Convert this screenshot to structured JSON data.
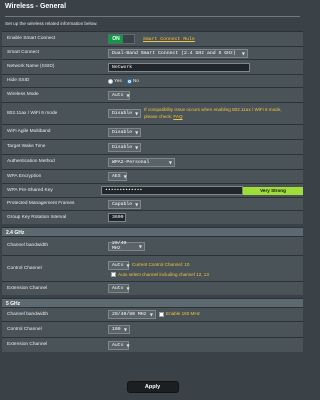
{
  "page": {
    "title": "Wireless - General",
    "description": "Set up the wireless related information below."
  },
  "general": {
    "smart_connect": {
      "label": "Enable Smart Connect",
      "toggle": "ON",
      "rule_link": "Smart Connect Rule"
    },
    "smart_connect_mode": {
      "label": "Smart Connect",
      "value": "Dual-Band Smart Connect (2.4 GHz and 5 GHz)"
    },
    "ssid": {
      "label": "Network Name (SSID)",
      "value": "Network"
    },
    "hide_ssid": {
      "label": "Hide SSID",
      "yes": "Yes",
      "no": "No",
      "selected": "No"
    },
    "wireless_mode": {
      "label": "Wireless Mode",
      "value": "Auto"
    },
    "wifi6_mode": {
      "label": "802.11ax / WiFi 6 mode",
      "value": "Disable",
      "note": "If compatibility issue occurs when enabling 802.11ax / WiFi 6 mode, please check:",
      "faq": "FAQ"
    },
    "agile_multiband": {
      "label": "WiFi Agile Multiband",
      "value": "Disable"
    },
    "target_wake_time": {
      "label": "Target Wake Time",
      "value": "Disable"
    },
    "auth_method": {
      "label": "Authentication Method",
      "value": "WPA2-Personal"
    },
    "wpa_encryption": {
      "label": "WPA Encryption",
      "value": "AES"
    },
    "wpa_psk": {
      "label": "WPA Pre-Shared Key",
      "value": "•••••••••••••",
      "strength": "Very Strong"
    },
    "pmf": {
      "label": "Protected Management Frames",
      "value": "Capable"
    },
    "group_key": {
      "label": "Group Key Rotation Interval",
      "value": "3600"
    }
  },
  "band24": {
    "heading": "2.4 GHz",
    "bandwidth": {
      "label": "Channel bandwidth",
      "value": "20/40 MHz"
    },
    "control_channel": {
      "label": "Control Channel",
      "value": "Auto",
      "current": "Current Control Channel: 10",
      "auto_select": "Auto select channel including channel 12, 13"
    },
    "extension_channel": {
      "label": "Extension Channel",
      "value": "Auto"
    }
  },
  "band5": {
    "heading": "5 GHz",
    "bandwidth": {
      "label": "Channel bandwidth",
      "value": "20/40/80 MHz",
      "enable_160": "Enable 160 MHz"
    },
    "control_channel": {
      "label": "Control Channel",
      "value": "100"
    },
    "extension_channel": {
      "label": "Extension Channel",
      "value": "Auto"
    }
  },
  "actions": {
    "apply": "Apply"
  },
  "colors": {
    "background": "#3a4247",
    "row": "#4a5358",
    "section": "#5d6970",
    "toggle_on": "#119a45",
    "note": "#f4c542",
    "strength": "#a0dc3a"
  },
  "icons": {
    "dropdown": "chevron-down-icon"
  }
}
